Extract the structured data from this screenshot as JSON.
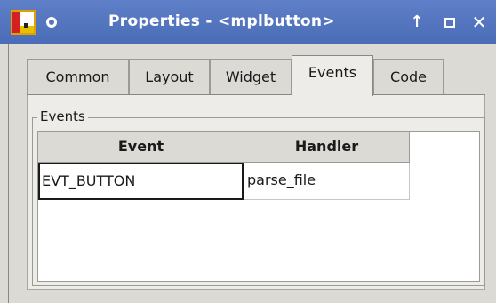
{
  "window": {
    "title": "Properties - <mplbutton>",
    "controls": {
      "up": "↑",
      "close": "✕"
    }
  },
  "tabs": [
    {
      "label": "Common"
    },
    {
      "label": "Layout"
    },
    {
      "label": "Widget"
    },
    {
      "label": "Events",
      "active": true
    },
    {
      "label": "Code"
    }
  ],
  "events_group": {
    "legend": "Events",
    "columns": [
      "Event",
      "Handler"
    ],
    "rows": [
      {
        "event": "EVT_BUTTON",
        "handler": "parse_file"
      }
    ]
  },
  "icons": [
    "app-icon",
    "pin-icon",
    "move-up-icon",
    "maximize-icon",
    "close-icon"
  ]
}
